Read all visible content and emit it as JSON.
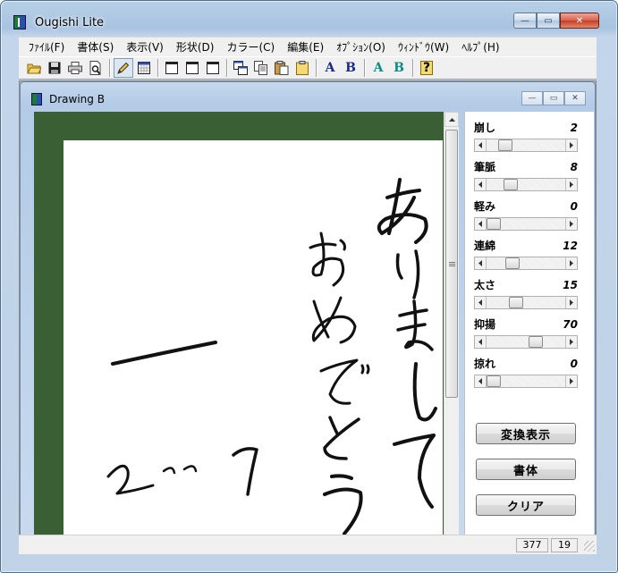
{
  "window": {
    "title": "Ougishi Lite",
    "minimize_glyph": "—",
    "maximize_glyph": "▭",
    "close_glyph": "✕"
  },
  "menu": [
    {
      "label": "ﾌｧｲﾙ(F)"
    },
    {
      "label": "書体(S)"
    },
    {
      "label": "表示(V)"
    },
    {
      "label": "形状(D)"
    },
    {
      "label": "カラー(C)"
    },
    {
      "label": "編集(E)"
    },
    {
      "label": "ｵﾌﾟｼｮﾝ(O)"
    },
    {
      "label": "ｳｨﾝﾄﾞｳ(W)"
    },
    {
      "label": "ﾍﾙﾌﾟ(H)"
    }
  ],
  "toolbar": {
    "letter_a1": "A",
    "letter_b1": "B",
    "letter_a2": "A",
    "letter_b2": "B",
    "help_glyph": "?",
    "color_dark_blue": "#1a2a8a",
    "color_teal": "#0f8a86"
  },
  "document": {
    "title": "Drawing B"
  },
  "sliders": [
    {
      "label": "崩し",
      "value": "2",
      "level": 0.2
    },
    {
      "label": "筆脈",
      "value": "8",
      "level": 0.3
    },
    {
      "label": "軽み",
      "value": "0",
      "level": 0.0
    },
    {
      "label": "連綿",
      "value": "12",
      "level": 0.35
    },
    {
      "label": "太さ",
      "value": "15",
      "level": 0.4
    },
    {
      "label": "抑揚",
      "value": "70",
      "level": 0.7
    },
    {
      "label": "掠れ",
      "value": "0",
      "level": 0.0
    }
  ],
  "buttons": {
    "convert": "変換表示",
    "typeface": "書体",
    "clear": "クリア"
  },
  "status": {
    "x": "377",
    "y": "19"
  },
  "colors": {
    "canvas_bg": "#3a5f34",
    "paper": "#ffffff",
    "ink": "#111111"
  }
}
